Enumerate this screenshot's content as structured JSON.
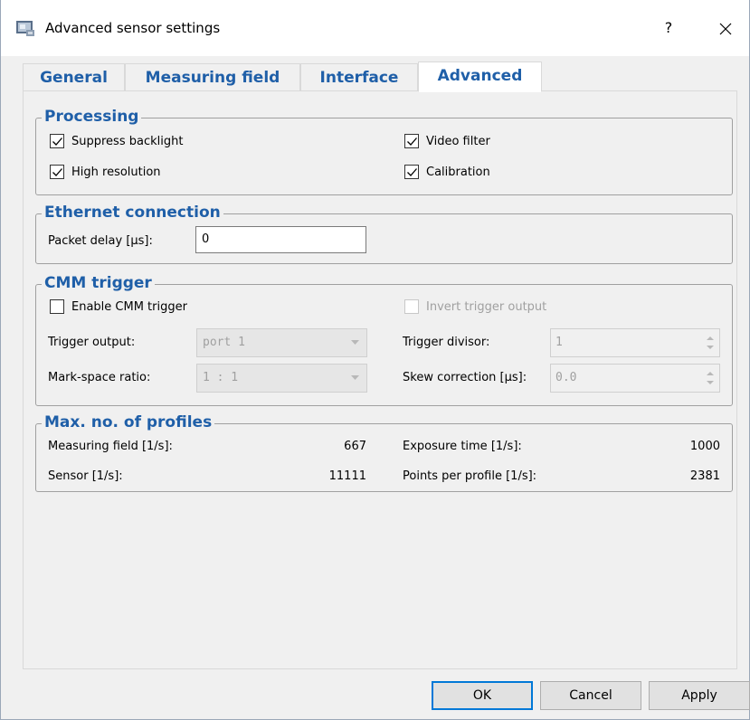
{
  "window": {
    "title": "Advanced sensor settings",
    "help_label": "?",
    "close_icon": "close-icon"
  },
  "tabs": [
    {
      "label": "General",
      "active": false
    },
    {
      "label": "Measuring field",
      "active": false
    },
    {
      "label": "Interface",
      "active": false
    },
    {
      "label": "Advanced",
      "active": true
    }
  ],
  "processing": {
    "title": "Processing",
    "suppress_backlight": {
      "label": "Suppress backlight",
      "checked": true
    },
    "high_resolution": {
      "label": "High resolution",
      "checked": true
    },
    "video_filter": {
      "label": "Video filter",
      "checked": true
    },
    "calibration": {
      "label": "Calibration",
      "checked": true
    }
  },
  "ethernet": {
    "title": "Ethernet connection",
    "packet_delay_label": "Packet delay [µs]:",
    "packet_delay_value": "0"
  },
  "cmm": {
    "title": "CMM trigger",
    "enable": {
      "label": "Enable CMM trigger",
      "checked": false
    },
    "invert": {
      "label": "Invert trigger output",
      "checked": false,
      "disabled": true
    },
    "trigger_output_label": "Trigger output:",
    "trigger_output_value": "port 1",
    "mark_space_label": "Mark-space ratio:",
    "mark_space_value": "1 : 1",
    "trigger_divisor_label": "Trigger divisor:",
    "trigger_divisor_value": "1",
    "skew_label": "Skew correction [µs]:",
    "skew_value": "0.0"
  },
  "profiles": {
    "title": "Max. no. of profiles",
    "measuring_field_label": "Measuring field [1/s]:",
    "measuring_field_value": "667",
    "sensor_label": "Sensor [1/s]:",
    "sensor_value": "11111",
    "exposure_label": "Exposure time [1/s]:",
    "exposure_value": "1000",
    "points_label": "Points per profile [1/s]:",
    "points_value": "2381"
  },
  "buttons": {
    "ok": "OK",
    "cancel": "Cancel",
    "apply": "Apply"
  },
  "colors": {
    "accent": "#1f5fa8",
    "dialog_bg": "#f0f0f0",
    "disabled_text": "#a0a0a0",
    "focus_border": "#0078d7"
  }
}
